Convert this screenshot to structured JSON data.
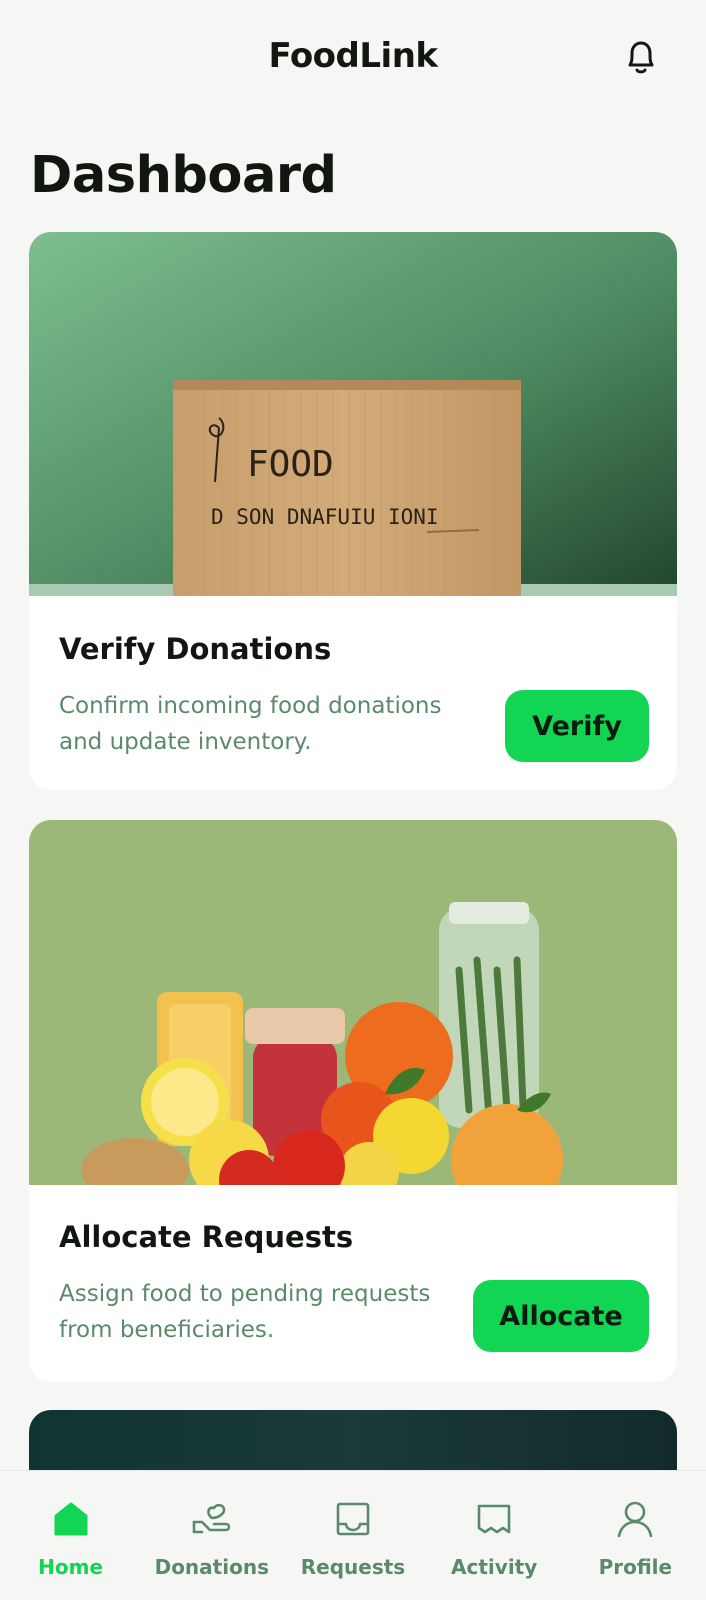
{
  "header": {
    "title": "FoodLink",
    "bell_icon": "bell-icon"
  },
  "page": {
    "title": "Dashboard"
  },
  "cards": [
    {
      "title": "Verify Donations",
      "description": "Confirm incoming food donations and update inventory.",
      "button_label": "Verify",
      "image": "cardboard-box-food-donation-photo",
      "box_text_line1": "FOOD",
      "box_text_line2": "D SON DNAFUIU IONI"
    },
    {
      "title": "Allocate Requests",
      "description": "Assign food to pending requests from beneficiaries.",
      "button_label": "Allocate",
      "image": "fruits-and-jars-photo"
    },
    {
      "image": "dark-teal-partial-card"
    }
  ],
  "bottom_nav": {
    "items": [
      {
        "label": "Home",
        "icon": "home-icon",
        "active": true
      },
      {
        "label": "Donations",
        "icon": "donations-hand-icon",
        "active": false
      },
      {
        "label": "Requests",
        "icon": "inbox-tray-icon",
        "active": false
      },
      {
        "label": "Activity",
        "icon": "activity-receipt-icon",
        "active": false
      },
      {
        "label": "Profile",
        "icon": "user-icon",
        "active": false
      }
    ]
  },
  "colors": {
    "accent": "#12d653",
    "muted_text": "#5a8a6a",
    "background": "#f6f7f5",
    "card_background": "#ffffff"
  }
}
